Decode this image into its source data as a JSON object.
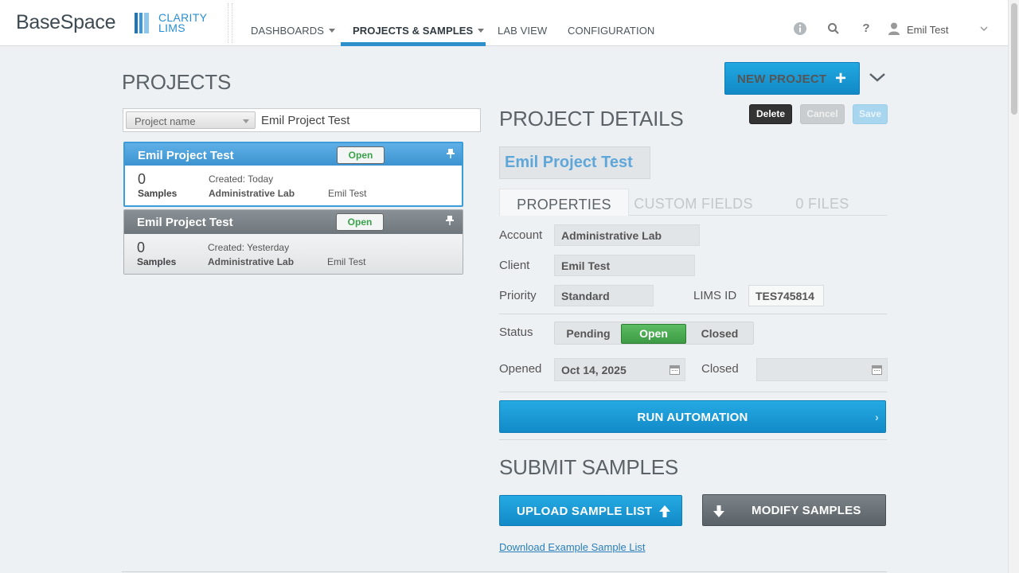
{
  "brand": {
    "name": "BaseSpace",
    "product_line1": "CLARITY",
    "product_line2": "LIMS"
  },
  "nav": {
    "items": [
      {
        "label": "DASHBOARDS"
      },
      {
        "label": "PROJECTS & SAMPLES"
      },
      {
        "label": "LAB VIEW"
      },
      {
        "label": "CONFIGURATION"
      }
    ],
    "active": "PROJECTS & SAMPLES"
  },
  "user": {
    "name": "Emil Test"
  },
  "projects": {
    "title": "PROJECTS",
    "search": {
      "filter_label": "Project name",
      "value": "Emil Project Test"
    },
    "cards": [
      {
        "title": "Emil Project Test",
        "status": "Open",
        "count": "0",
        "count_label": "Samples",
        "created": "Created: Today",
        "lab": "Administrative Lab",
        "owner": "Emil Test"
      },
      {
        "title": "Emil Project Test",
        "status": "Open",
        "count": "0",
        "count_label": "Samples",
        "created": "Created: Yesterday",
        "lab": "Administrative Lab",
        "owner": "Emil Test"
      }
    ]
  },
  "actions": {
    "new_project": "NEW PROJECT",
    "delete": "Delete",
    "cancel": "Cancel",
    "save": "Save"
  },
  "details": {
    "title": "PROJECT DETAILS",
    "project_name": "Emil Project Test",
    "tabs": [
      {
        "label": "PROPERTIES"
      },
      {
        "label": "CUSTOM FIELDS"
      },
      {
        "label": "0 FILES"
      }
    ],
    "active_tab": "PROPERTIES",
    "fields": {
      "account_label": "Account",
      "account": "Administrative Lab",
      "client_label": "Client",
      "client": "Emil Test",
      "priority_label": "Priority",
      "priority": "Standard",
      "lims_id_label": "LIMS ID",
      "lims_id": "TES745814",
      "status_label": "Status",
      "status_options": [
        "Pending",
        "Open",
        "Closed"
      ],
      "status_selected": "Open",
      "opened_label": "Opened",
      "opened": "Oct 14, 2025",
      "closed_label": "Closed",
      "closed": ""
    },
    "run_automation": "RUN AUTOMATION"
  },
  "submit": {
    "title": "SUBMIT SAMPLES",
    "upload": "UPLOAD SAMPLE LIST",
    "modify": "MODIFY SAMPLES",
    "download_link": "Download Example Sample List"
  },
  "colors": {
    "accent": "#1a98d5",
    "open_green": "#3aa24a",
    "header_bg": "#ffffff",
    "page_bg": "#eef1f3"
  }
}
